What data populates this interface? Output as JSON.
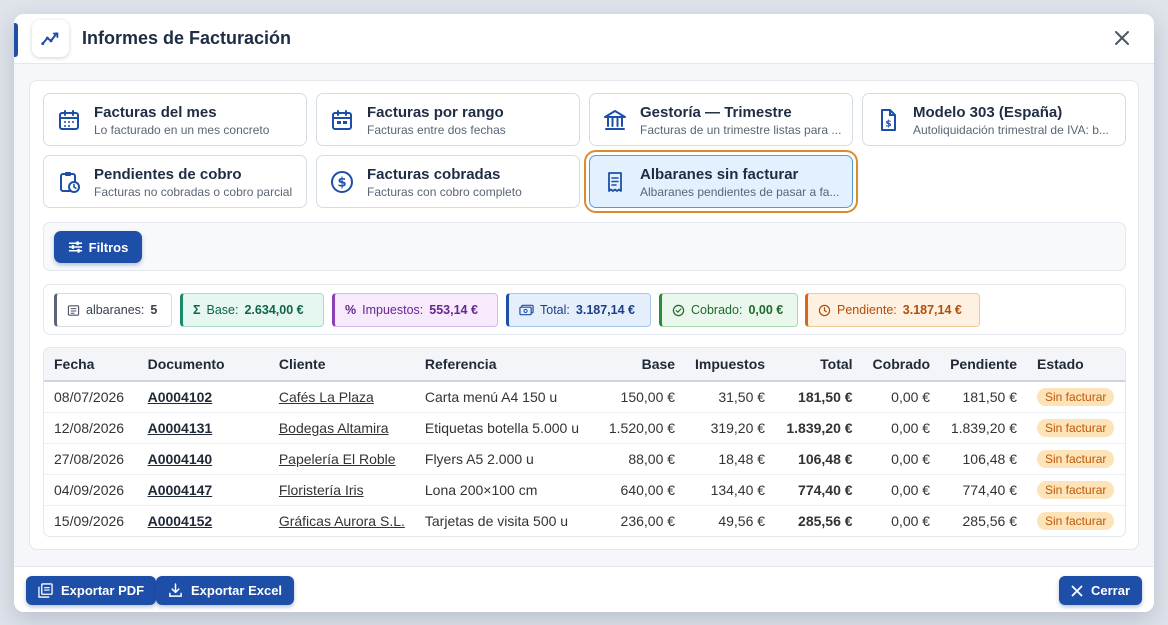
{
  "header": {
    "title": "Informes de Facturación"
  },
  "reports": [
    {
      "title": "Facturas del mes",
      "subtitle": "Lo facturado en un mes concreto",
      "icon": "calendar-icon"
    },
    {
      "title": "Facturas por rango",
      "subtitle": "Facturas entre dos fechas",
      "icon": "calendar-range-icon"
    },
    {
      "title": "Gestoría — Trimestre",
      "subtitle": "Facturas de un trimestre listas para ...",
      "icon": "bank-icon"
    },
    {
      "title": "Modelo 303 (España)",
      "subtitle": "Autoliquidación trimestral de IVA: b...",
      "icon": "tax-document-icon"
    },
    {
      "title": "Pendientes de cobro",
      "subtitle": "Facturas no cobradas o cobro parcial",
      "icon": "clipboard-clock-icon"
    },
    {
      "title": "Facturas cobradas",
      "subtitle": "Facturas con cobro completo",
      "icon": "dollar-circle-icon"
    },
    {
      "title": "Albaranes sin facturar",
      "subtitle": "Albaranes pendientes de pasar a fa...",
      "icon": "receipt-icon",
      "active": true
    }
  ],
  "filters": {
    "label": "Filtros"
  },
  "summary": {
    "count": {
      "label": "albaranes:",
      "value": "5"
    },
    "base": {
      "label": "Base:",
      "value": "2.634,00 €"
    },
    "taxes": {
      "label": "Impuestos:",
      "value": "553,14 €"
    },
    "total": {
      "label": "Total:",
      "value": "3.187,14 €"
    },
    "paid": {
      "label": "Cobrado:",
      "value": "0,00 €"
    },
    "pending": {
      "label": "Pendiente:",
      "value": "3.187,14 €"
    }
  },
  "table": {
    "columns": [
      "Fecha",
      "Documento",
      "Cliente",
      "Referencia",
      "Base",
      "Impuestos",
      "Total",
      "Cobrado",
      "Pendiente",
      "Estado"
    ],
    "rows": [
      {
        "fecha": "08/07/2026",
        "doc": "A0004102",
        "cliente": "Cafés La Plaza",
        "ref": "Carta menú A4 150 u",
        "base": "150,00 €",
        "imp": "31,50 €",
        "total": "181,50 €",
        "cobrado": "0,00 €",
        "pend": "181,50 €",
        "estado": "Sin facturar"
      },
      {
        "fecha": "12/08/2026",
        "doc": "A0004131",
        "cliente": "Bodegas Altamira",
        "ref": "Etiquetas botella 5.000 u",
        "base": "1.520,00 €",
        "imp": "319,20 €",
        "total": "1.839,20 €",
        "cobrado": "0,00 €",
        "pend": "1.839,20 €",
        "estado": "Sin facturar"
      },
      {
        "fecha": "27/08/2026",
        "doc": "A0004140",
        "cliente": "Papelería El Roble",
        "ref": "Flyers A5 2.000 u",
        "base": "88,00 €",
        "imp": "18,48 €",
        "total": "106,48 €",
        "cobrado": "0,00 €",
        "pend": "106,48 €",
        "estado": "Sin facturar"
      },
      {
        "fecha": "04/09/2026",
        "doc": "A0004147",
        "cliente": "Floristería Iris",
        "ref": "Lona 200×100 cm",
        "base": "640,00 €",
        "imp": "134,40 €",
        "total": "774,40 €",
        "cobrado": "0,00 €",
        "pend": "774,40 €",
        "estado": "Sin facturar"
      },
      {
        "fecha": "15/09/2026",
        "doc": "A0004152",
        "cliente": "Gráficas Aurora S.L.",
        "ref": "Tarjetas de visita 500 u",
        "base": "236,00 €",
        "imp": "49,56 €",
        "total": "285,56 €",
        "cobrado": "0,00 €",
        "pend": "285,56 €",
        "estado": "Sin facturar"
      }
    ]
  },
  "footer": {
    "export_pdf": "Exportar PDF",
    "export_excel": "Exportar Excel",
    "close": "Cerrar"
  },
  "colors": {
    "primary": "#1e4fa8",
    "active_outline": "#d98c2e",
    "badge_bg": "#fde3b8",
    "badge_text": "#c0580a"
  }
}
